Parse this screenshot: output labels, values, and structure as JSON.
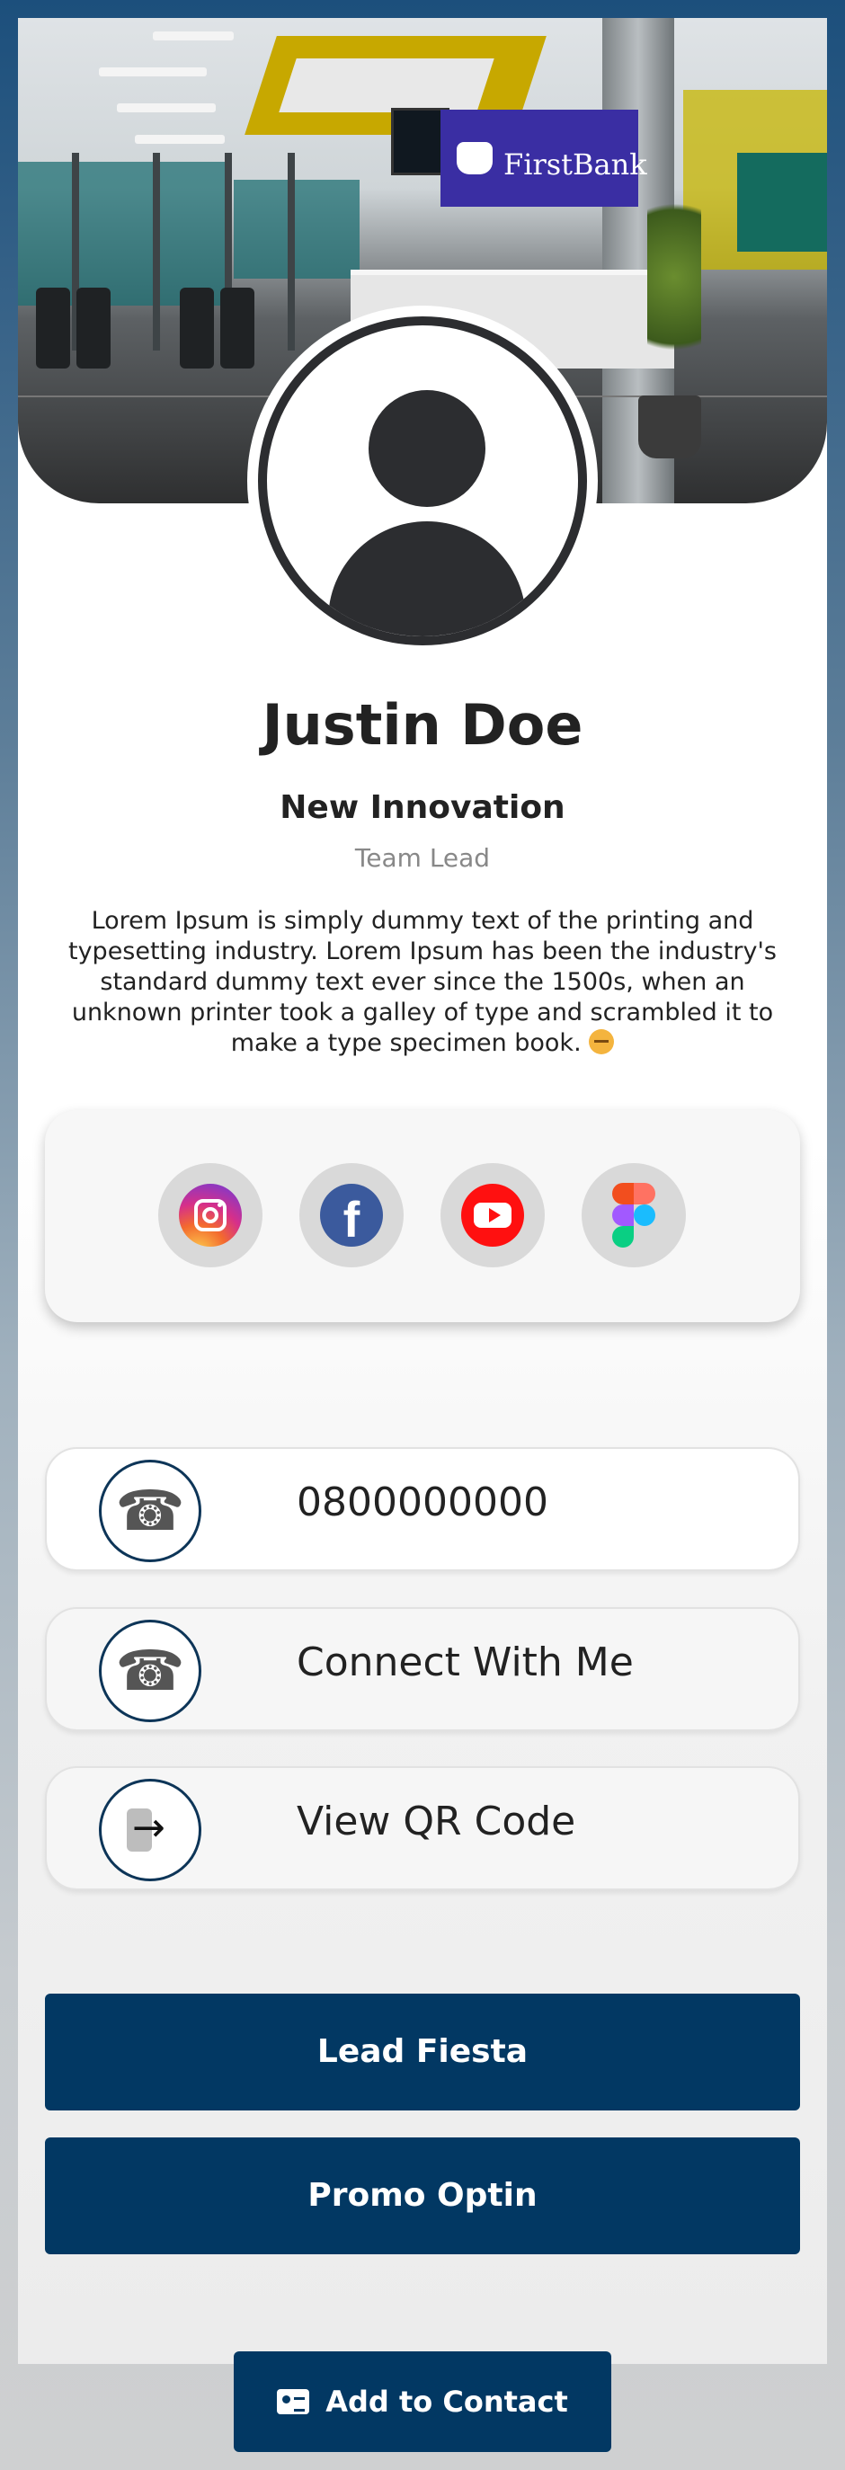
{
  "cover": {
    "sign_text": "FirstBank"
  },
  "profile": {
    "name": "Justin Doe",
    "company": "New Innovation",
    "role": "Team Lead",
    "bio": "Lorem Ipsum is simply dummy text of the printing and typesetting industry. Lorem Ipsum has been the industry's standard dummy text ever since the 1500s, when an unknown printer took a galley of type and scrambled it to make a type specimen book."
  },
  "social": [
    {
      "icon": "instagram-icon"
    },
    {
      "icon": "facebook-icon",
      "glyph": "f"
    },
    {
      "icon": "youtube-icon"
    },
    {
      "icon": "figma-icon"
    }
  ],
  "contacts": [
    {
      "icon": "phone-icon",
      "label": "0800000000"
    },
    {
      "icon": "phone-icon",
      "label": "Connect With Me"
    },
    {
      "icon": "qr-code-icon",
      "label": "View QR Code"
    }
  ],
  "buttons": {
    "lead": "Lead Fiesta",
    "promo": "Promo Optin",
    "add_contact": "Add to Contact"
  },
  "colors": {
    "primary": "#023863",
    "icon_border": "#0d3558",
    "instagram": "#d62f8a",
    "facebook": "#3b5a9d",
    "youtube": "#ff1010"
  }
}
